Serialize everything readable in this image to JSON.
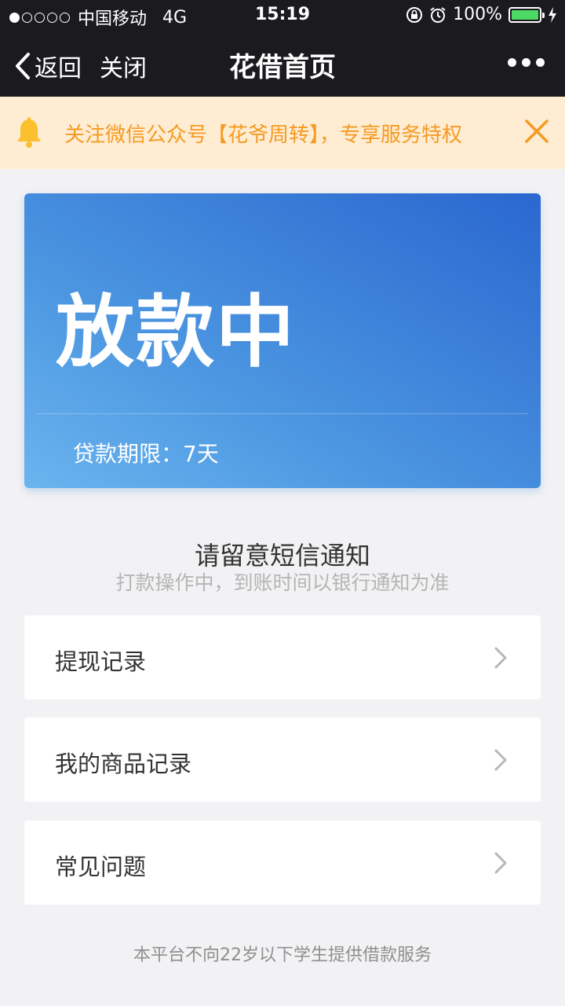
{
  "status_bar": {
    "carrier": "中国移动",
    "network": "4G",
    "time": "15:19",
    "battery": "100%",
    "battery_color": "#4cd964"
  },
  "navbar": {
    "back_label": "返回",
    "close_label": "关闭",
    "title": "花借首页"
  },
  "notice": {
    "text": "关注微信公众号【花爷周转】，专享服务特权",
    "color": "#f59a23",
    "background": "#feedd3"
  },
  "card": {
    "status": "放款中",
    "term": "贷款期限：7天"
  },
  "hint": {
    "title": "请留意短信通知",
    "subtitle": "打款操作中，到账时间以银行通知为准"
  },
  "menu": {
    "items": [
      {
        "label": "提现记录"
      },
      {
        "label": "我的商品记录"
      },
      {
        "label": "常见问题"
      }
    ]
  },
  "footer": {
    "text": "本平台不向22岁以下学生提供借款服务"
  }
}
